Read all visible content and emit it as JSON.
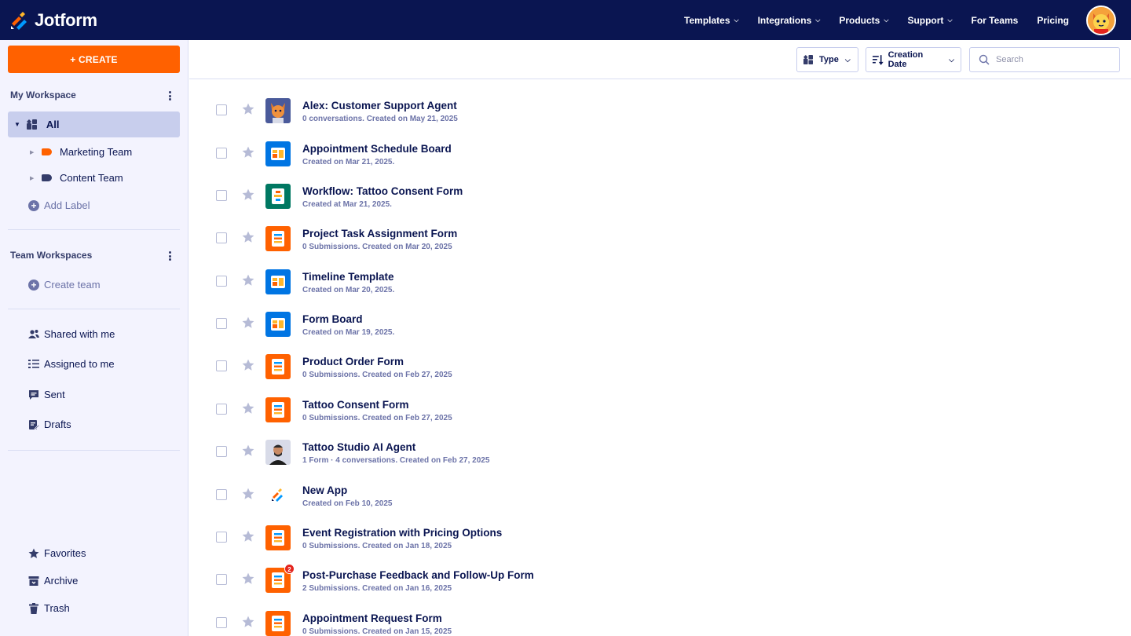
{
  "brand": {
    "name": "Jotform"
  },
  "nav": {
    "items": [
      {
        "label": "Templates",
        "dropdown": true
      },
      {
        "label": "Integrations",
        "dropdown": true
      },
      {
        "label": "Products",
        "dropdown": true
      },
      {
        "label": "Support",
        "dropdown": true
      },
      {
        "label": "For Teams",
        "dropdown": false
      },
      {
        "label": "Pricing",
        "dropdown": false
      }
    ]
  },
  "sidebar": {
    "create_label": "+ CREATE",
    "my_workspace": {
      "title": "My Workspace",
      "all_label": "All",
      "labels": [
        {
          "name": "Marketing Team",
          "color": "#ff6100"
        },
        {
          "name": "Content Team",
          "color": "#343c6a"
        }
      ],
      "add_label": "Add Label"
    },
    "team_workspaces": {
      "title": "Team Workspaces",
      "create_team": "Create team"
    },
    "links": [
      {
        "label": "Shared with me",
        "icon": "shared-users-icon"
      },
      {
        "label": "Assigned to me",
        "icon": "checklist-icon"
      },
      {
        "label": "Sent",
        "icon": "sent-message-icon"
      },
      {
        "label": "Drafts",
        "icon": "drafts-icon"
      }
    ],
    "bottom_links": [
      {
        "label": "Favorites",
        "icon": "star-icon"
      },
      {
        "label": "Archive",
        "icon": "archive-icon"
      },
      {
        "label": "Trash",
        "icon": "trash-icon"
      }
    ]
  },
  "toolbar": {
    "type_label": "Type",
    "sort_label": "Creation Date",
    "search_placeholder": "Search"
  },
  "items": [
    {
      "title": "Alex: Customer Support Agent",
      "meta": "0 conversations. Created on May 21, 2025",
      "kind": "agent-fox"
    },
    {
      "title": "Appointment Schedule Board",
      "meta": "Created on Mar 21, 2025.",
      "kind": "board"
    },
    {
      "title": "Workflow: Tattoo Consent Form",
      "meta": "Created at Mar 21, 2025.",
      "kind": "workflow"
    },
    {
      "title": "Project Task Assignment Form",
      "meta": "0 Submissions. Created on Mar 20, 2025",
      "kind": "form"
    },
    {
      "title": "Timeline Template",
      "meta": "Created on Mar 20, 2025.",
      "kind": "board"
    },
    {
      "title": "Form Board",
      "meta": "Created on Mar 19, 2025.",
      "kind": "board"
    },
    {
      "title": "Product Order Form",
      "meta": "0 Submissions. Created on Feb 27, 2025",
      "kind": "form"
    },
    {
      "title": "Tattoo Consent Form",
      "meta": "0 Submissions. Created on Feb 27, 2025",
      "kind": "form"
    },
    {
      "title": "Tattoo Studio AI Agent",
      "meta": "1 Form · 4 conversations. Created on Feb 27, 2025",
      "kind": "agent-person"
    },
    {
      "title": "New App",
      "meta": "Created on Feb 10, 2025",
      "kind": "app"
    },
    {
      "title": "Event Registration with Pricing Options",
      "meta": "0 Submissions. Created on Jan 18, 2025",
      "kind": "form"
    },
    {
      "title": "Post-Purchase Feedback and Follow-Up Form",
      "meta": "2 Submissions. Created on Jan 16, 2025",
      "kind": "form",
      "badge": "2"
    },
    {
      "title": "Appointment Request Form",
      "meta": "0 Submissions. Created on Jan 15, 2025",
      "kind": "form"
    }
  ],
  "colors": {
    "navy": "#0a1551",
    "orange": "#ff6100",
    "board_blue": "#0075e3",
    "workflow_green": "#007862",
    "sidebar_bg": "#f3f3fe",
    "selected_bg": "#c8ceed"
  }
}
